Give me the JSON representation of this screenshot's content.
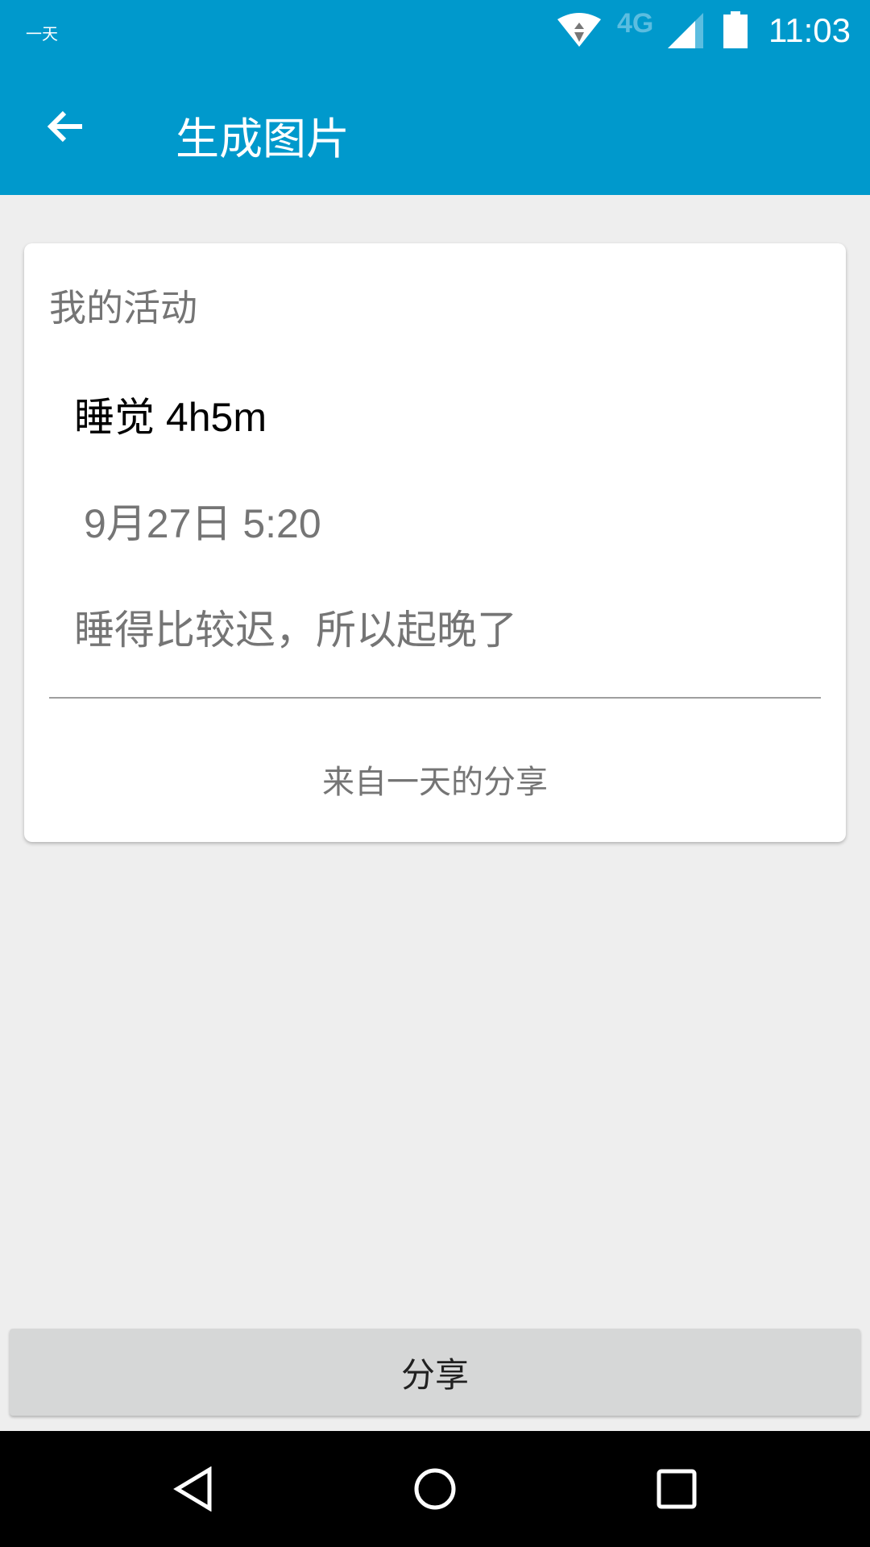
{
  "status_bar": {
    "app_name": "一天",
    "network": "4G",
    "time": "11:03"
  },
  "app_bar": {
    "title": "生成图片"
  },
  "card": {
    "title": "我的活动",
    "activity": "睡觉 4h5m",
    "date": "9月27日 5:20",
    "note": "睡得比较迟，所以起晚了",
    "footer": "来自一天的分享"
  },
  "share_button": {
    "label": "分享"
  },
  "colors": {
    "primary": "#0099cc",
    "background": "#eeeeee",
    "button": "#d6d7d7"
  }
}
